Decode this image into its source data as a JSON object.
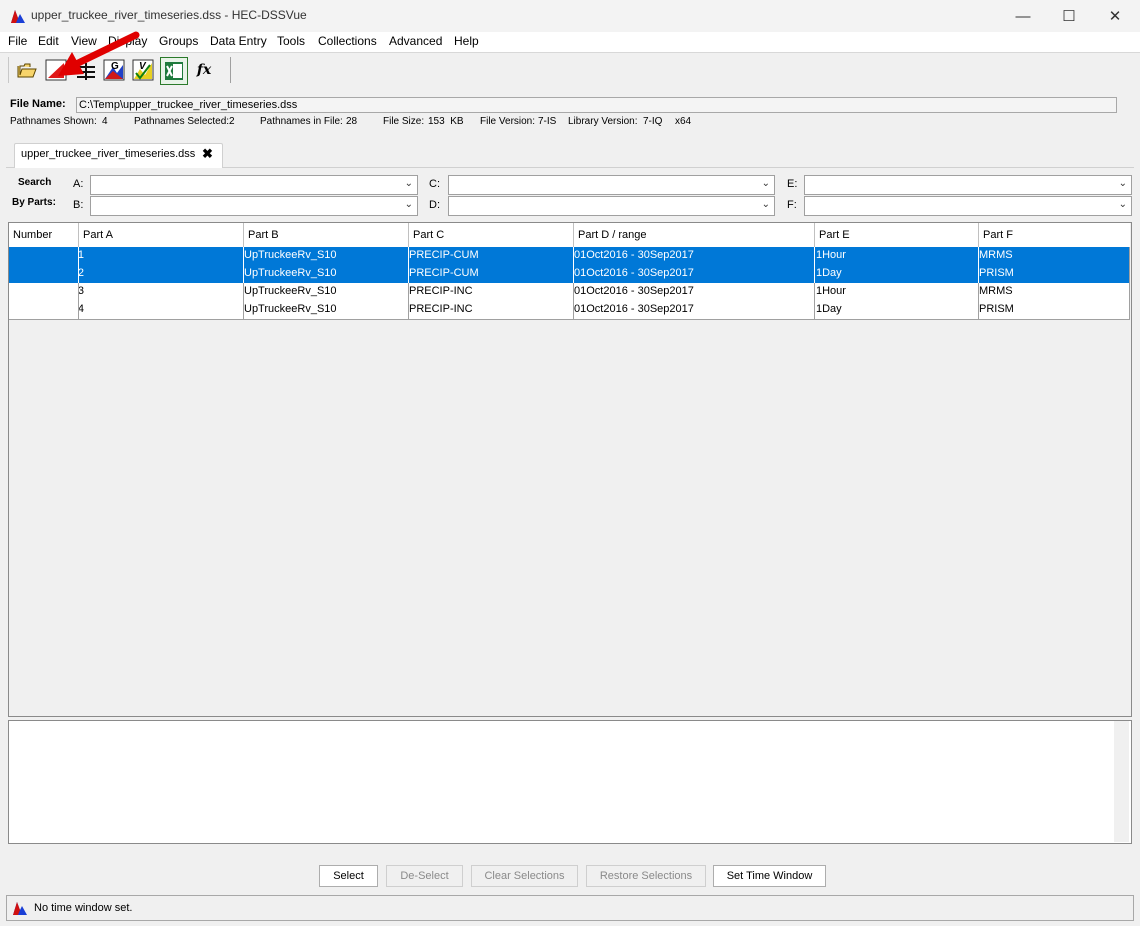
{
  "window": {
    "title": "upper_truckee_river_timeseries.dss - HEC-DSSVue",
    "minimize_glyph": "—",
    "maximize_glyph": "☐",
    "close_glyph": "✕"
  },
  "menu": [
    "File",
    "Edit",
    "View",
    "Display",
    "Groups",
    "Data Entry",
    "Tools",
    "Collections",
    "Advanced",
    "Help"
  ],
  "toolbar": {
    "icons": [
      "open-folder-icon",
      "plot-icon",
      "tabulate-icon",
      "graph-icon",
      "validate-icon",
      "excel-icon",
      "math-function-icon"
    ],
    "fx_label": "fx",
    "graph_letter": "G",
    "validate_letter": "V"
  },
  "file_info": {
    "file_name_label": "File Name:",
    "file_name": "C:\\Temp\\upper_truckee_river_timeseries.dss",
    "pathnames_shown_label": "Pathnames Shown:",
    "pathnames_shown": "4",
    "pathnames_selected_label": "Pathnames Selected:",
    "pathnames_selected": "2",
    "pathnames_in_file_label": "Pathnames in File:",
    "pathnames_in_file": "28",
    "file_size_label": "File Size:",
    "file_size": "153  KB",
    "file_version_label": "File Version:",
    "file_version": "7-IS",
    "library_version_label": "Library Version:",
    "library_version": "7-IQ",
    "arch": "x64"
  },
  "tab": {
    "label": "upper_truckee_river_timeseries.dss",
    "close_glyph": "✖"
  },
  "search": {
    "title_line1": "Search",
    "title_line2": "By Parts:",
    "parts": {
      "a": "A:",
      "b": "B:",
      "c": "C:",
      "d": "D:",
      "e": "E:",
      "f": "F:"
    },
    "values": {
      "a": "",
      "b": "",
      "c": "",
      "d": "",
      "e": "",
      "f": ""
    },
    "arrow_glyph": "⌄"
  },
  "table": {
    "columns": [
      "Number",
      "Part A",
      "Part B",
      "Part C",
      "Part D / range",
      "Part E",
      "Part F"
    ],
    "rows": [
      {
        "number": "1",
        "a": "",
        "b": "UpTruckeeRv_S10",
        "c": "PRECIP-CUM",
        "d": "01Oct2016 - 30Sep2017",
        "e": "1Hour",
        "f": "MRMS",
        "selected": true
      },
      {
        "number": "2",
        "a": "",
        "b": "UpTruckeeRv_S10",
        "c": "PRECIP-CUM",
        "d": "01Oct2016 - 30Sep2017",
        "e": "1Day",
        "f": "PRISM",
        "selected": true
      },
      {
        "number": "3",
        "a": "",
        "b": "UpTruckeeRv_S10",
        "c": "PRECIP-INC",
        "d": "01Oct2016 - 30Sep2017",
        "e": "1Hour",
        "f": "MRMS",
        "selected": false
      },
      {
        "number": "4",
        "a": "",
        "b": "UpTruckeeRv_S10",
        "c": "PRECIP-INC",
        "d": "01Oct2016 - 30Sep2017",
        "e": "1Day",
        "f": "PRISM",
        "selected": false
      }
    ]
  },
  "buttons": {
    "select": "Select",
    "deselect": "De-Select",
    "clear": "Clear Selections",
    "restore": "Restore Selections",
    "time_window": "Set Time Window"
  },
  "status": {
    "text": "No time window set."
  },
  "colors": {
    "selection": "#0078d7",
    "annotation_arrow": "#e00000"
  }
}
